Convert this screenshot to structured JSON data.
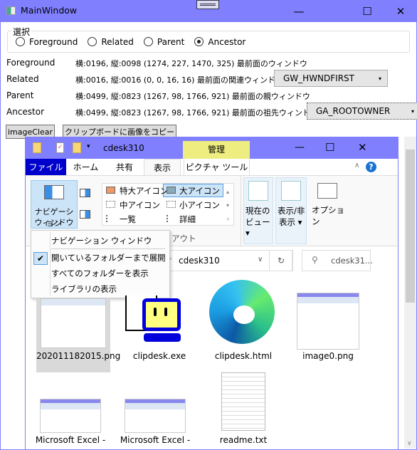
{
  "window": {
    "title": "MainWindow",
    "icon": "app-window-icon"
  },
  "selection": {
    "group_label": "選択",
    "options": [
      "Foreground",
      "Related",
      "Parent",
      "Ancestor"
    ],
    "selected": "Ancestor"
  },
  "rows": [
    {
      "label": "Foreground",
      "info": "横:0196, 縦:0098  (1274, 227, 1470, 325) 最前面のウィンドウ"
    },
    {
      "label": "Related",
      "info": "横:0016, 縦:0016  (0, 0, 16, 16) 最前面の関連ウィンドウ",
      "combo": "GW_HWNDFIRST"
    },
    {
      "label": "Parent",
      "info": "横:0499, 縦:0823  (1267, 98, 1766, 921) 最前面の親ウィンドウ"
    },
    {
      "label": "Ancestor",
      "info": "横:0499, 縦:0823  (1267, 98, 1766, 921) 最前面の祖先ウィンドウ",
      "combo": "GA_ROOTOWNER"
    }
  ],
  "buttons": {
    "clear": "imageClear",
    "copy": "クリップボードに画像をコピー"
  },
  "explorer": {
    "title": "cdesk310",
    "context_tab": "管理",
    "tabs": [
      "ファイル",
      "ホーム",
      "共有",
      "表示",
      "ピクチャ ツール"
    ],
    "active_tab": "表示",
    "nav_pane": [
      "ナビゲーション",
      "ウィンドウ ▾"
    ],
    "layouts": [
      "特大アイコン",
      "大アイコン",
      "中アイコン",
      "小アイコン",
      "一覧",
      "詳細"
    ],
    "selected_layout": "大アイコン",
    "layout_group": "アウト",
    "current_view": [
      "現在の",
      "ビュー ▾"
    ],
    "show_hide": [
      "表示/非",
      "表示 ▾"
    ],
    "options": "オプション",
    "menu": [
      "ナビゲーション ウィンドウ",
      "開いているフォルダーまで展開",
      "すべてのフォルダーを表示",
      "ライブラリの表示"
    ],
    "menu_checked": "開いているフォルダーまで展開",
    "address": "cdesk310",
    "search_placeholder": "cdesk31...",
    "files": [
      "202011182015.png",
      "clipdesk.exe",
      "clipdesk.html",
      "image0.png",
      "Microsoft Excel -",
      "Microsoft Excel -",
      "readme.txt"
    ]
  },
  "colors": {
    "titlebar": "#8080ff",
    "context_tab": "#eded80",
    "file_tab": "#0000cc"
  }
}
